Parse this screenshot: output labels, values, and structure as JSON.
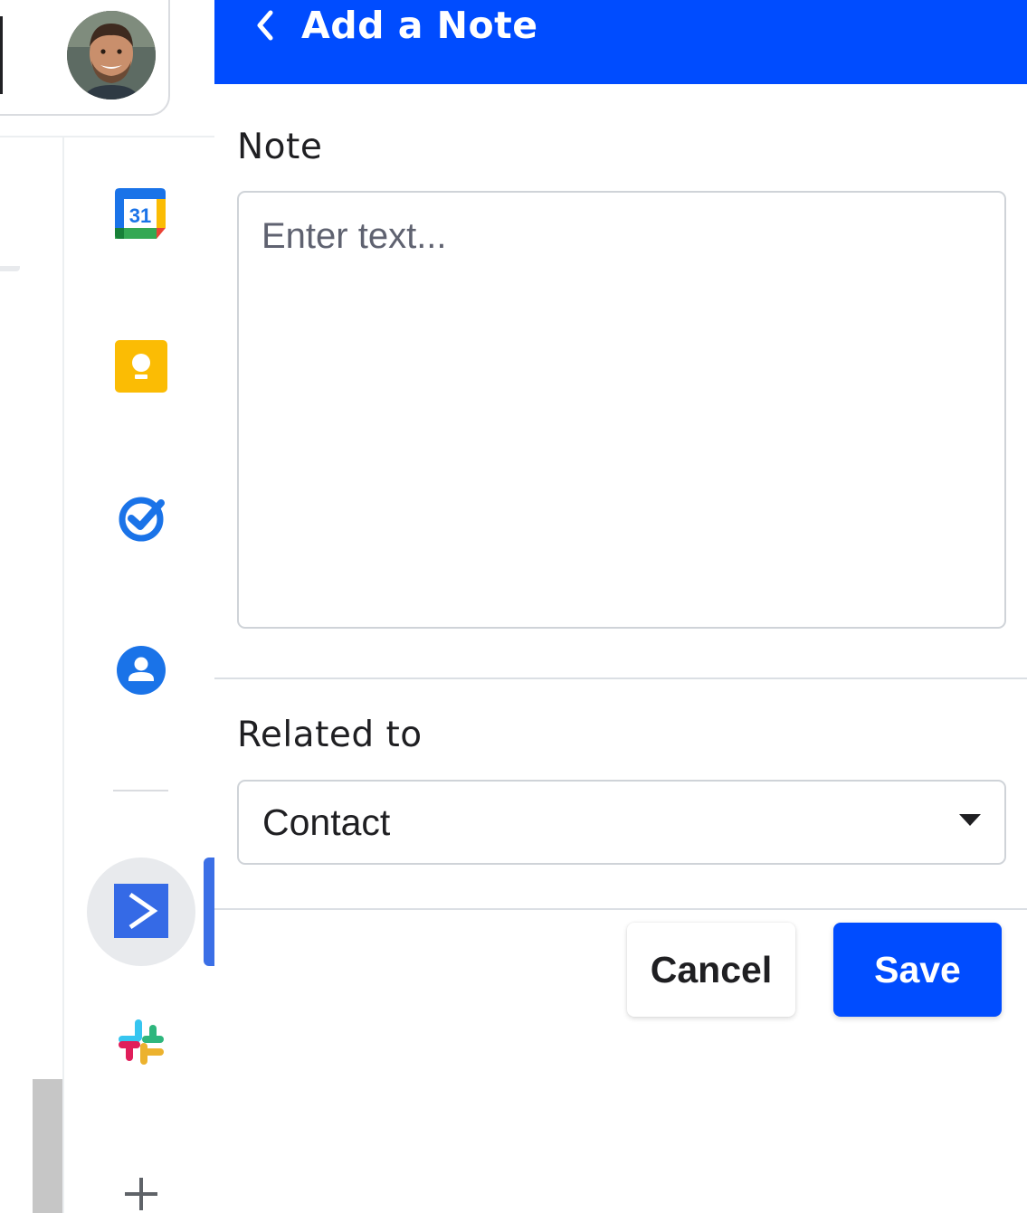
{
  "header": {
    "title": "Add a Note",
    "back_icon": "chevron-left-icon",
    "background_color": "#004cff"
  },
  "note": {
    "label": "Note",
    "placeholder": "Enter text...",
    "value": ""
  },
  "related": {
    "label": "Related to",
    "selected": "Contact",
    "icon": "caret-down-icon"
  },
  "actions": {
    "cancel_label": "Cancel",
    "save_label": "Save"
  },
  "side_rail": {
    "items": [
      {
        "name": "google-calendar",
        "icon": "calendar-icon",
        "text": "31"
      },
      {
        "name": "google-keep",
        "icon": "keep-icon"
      },
      {
        "name": "google-tasks",
        "icon": "tasks-icon"
      },
      {
        "name": "google-contacts",
        "icon": "contacts-icon"
      },
      {
        "name": "activecampaign",
        "icon": "activecampaign-icon",
        "active": true
      },
      {
        "name": "slack",
        "icon": "slack-icon"
      },
      {
        "name": "add-addon",
        "icon": "plus-icon"
      }
    ]
  },
  "colors": {
    "accent": "#004cff",
    "active_bar": "#3b6fe6"
  }
}
